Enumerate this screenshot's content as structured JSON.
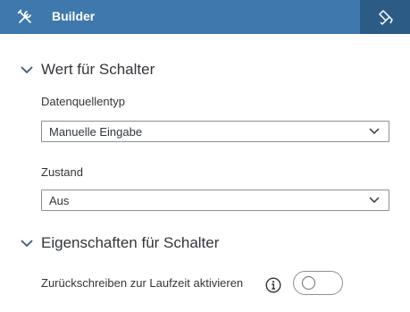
{
  "header": {
    "title": "Builder",
    "left_icon": "tools-icon",
    "right_button_icon": "format-paint-icon",
    "colors": {
      "background": "#3f78ad",
      "active_button": "#2c5b86"
    }
  },
  "sections": {
    "switch_value": {
      "title": "Wert für Schalter",
      "expanded": true,
      "data_source_type": {
        "label": "Datenquellentyp",
        "value": "Manuelle Eingabe"
      },
      "state": {
        "label": "Zustand",
        "value": "Aus"
      }
    },
    "switch_properties": {
      "title": "Eigenschaften für Schalter",
      "expanded": true,
      "writeback": {
        "label": "Zurückschreiben zur Laufzeit aktivieren",
        "on": false,
        "info_icon": "info-icon"
      }
    }
  }
}
